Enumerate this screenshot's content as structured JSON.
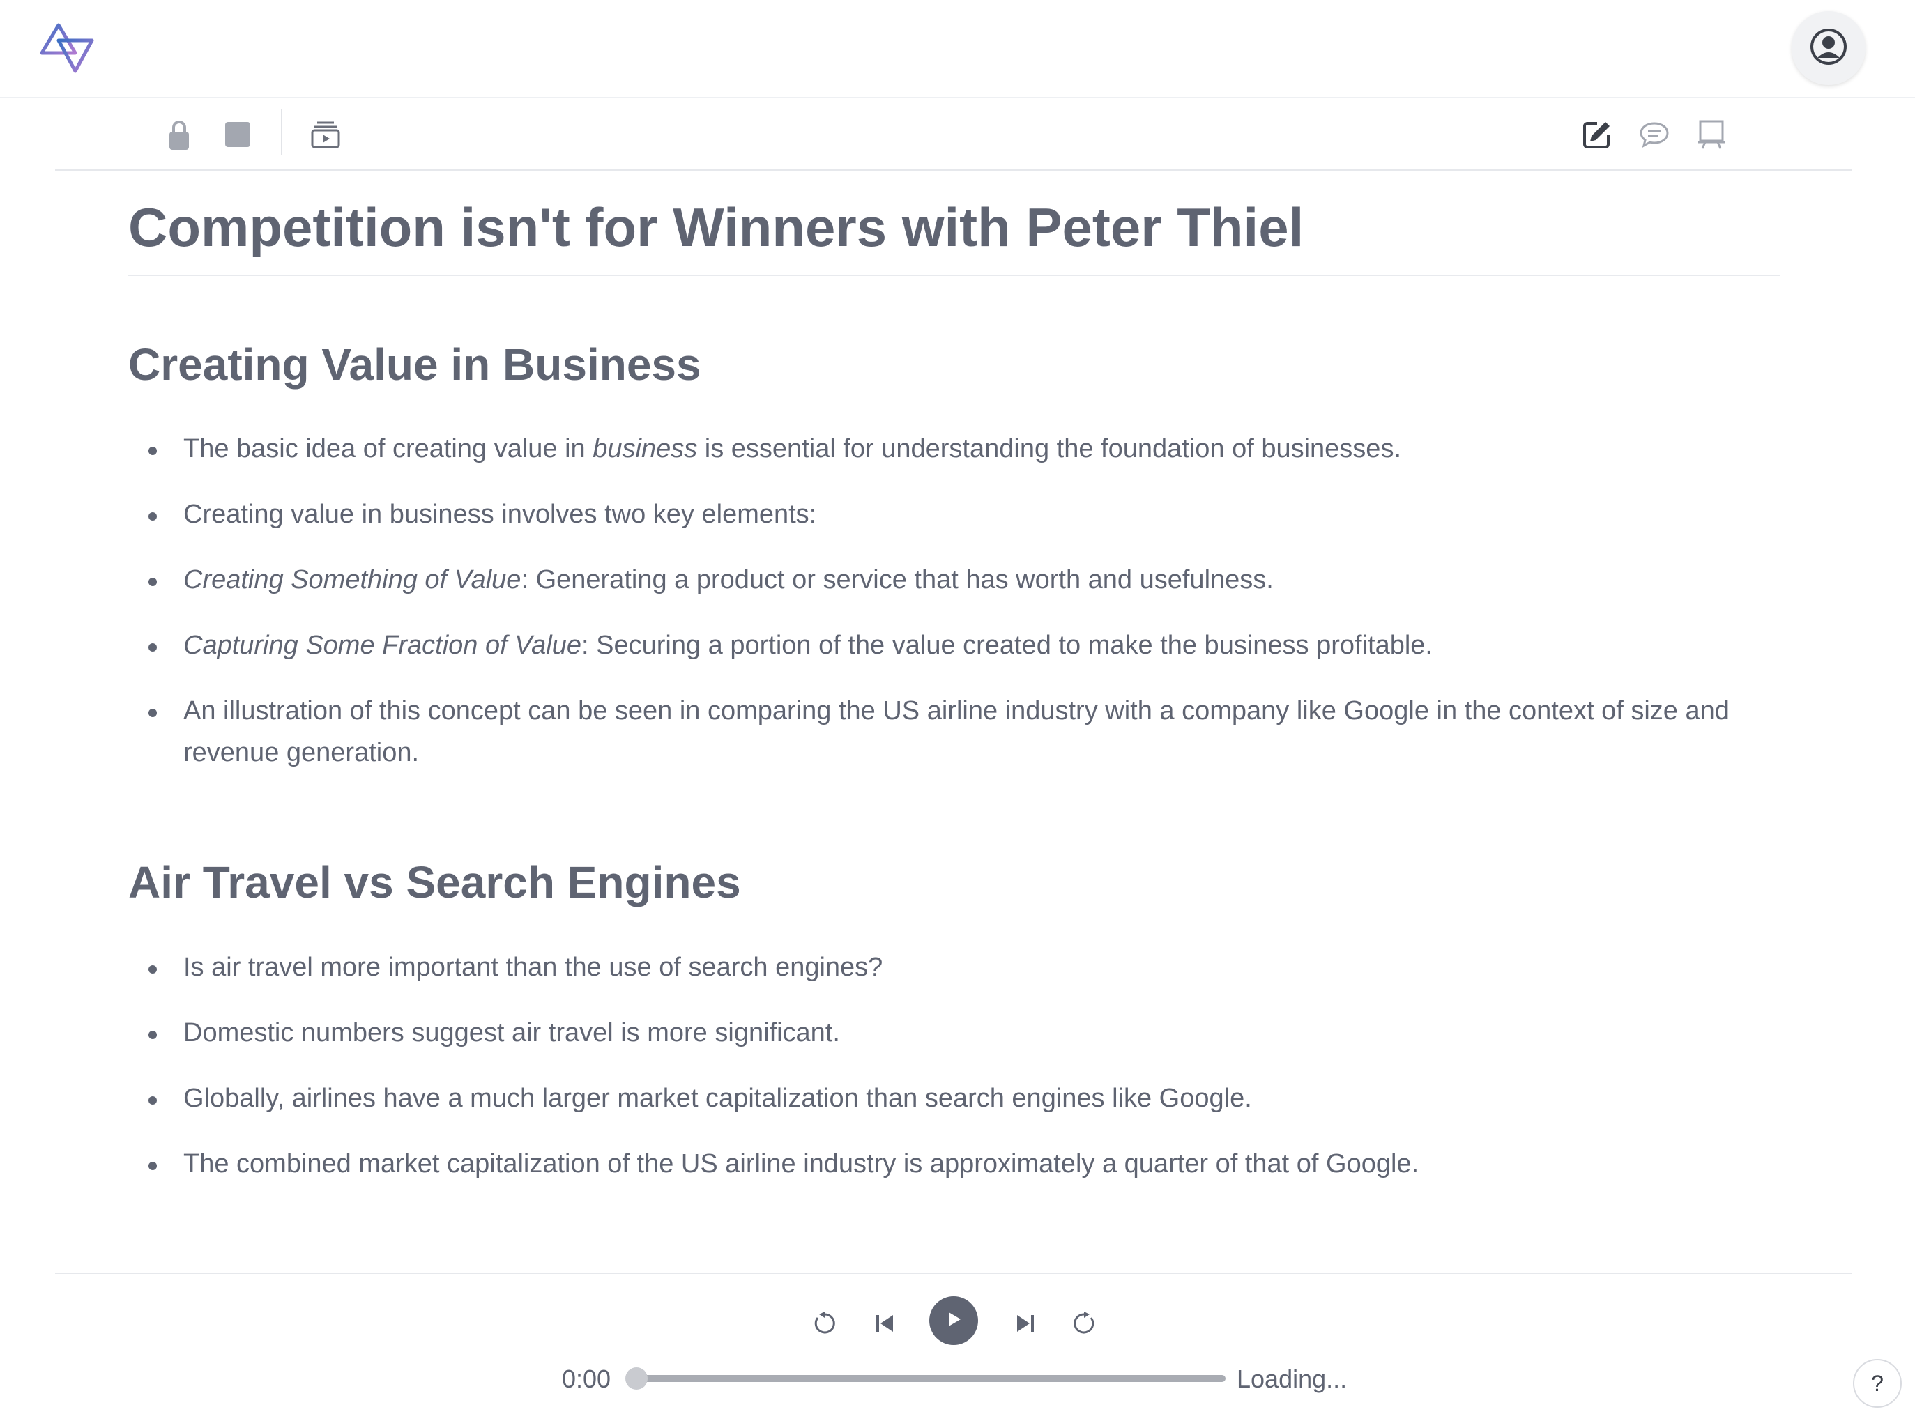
{
  "header": {
    "logo_icon": "triangles-logo-icon",
    "profile_icon": "user-circle-icon"
  },
  "toolbar": {
    "left_icons": [
      "lock-icon",
      "square-icon",
      "slideshow-icon"
    ],
    "right_icons": [
      "edit-icon",
      "comment-icon",
      "presentation-board-icon"
    ]
  },
  "document": {
    "title": "Competition isn't for Winners with Peter Thiel",
    "sections": [
      {
        "heading": "Creating Value in Business",
        "bullets": [
          {
            "before": " The basic idea of creating value in ",
            "em": "business",
            "after": " is essential for understanding the foundation of businesses."
          },
          {
            "before": " Creating value in business involves two key elements:",
            "em": "",
            "after": ""
          },
          {
            "before": "",
            "em": "Creating Something of Value",
            "after": ": Generating a product or service that has worth and usefulness."
          },
          {
            "before": " ",
            "em": "Capturing Some Fraction of Value",
            "after": ": Securing a portion of the value created to make the business profitable."
          },
          {
            "before": " An illustration of this concept can be seen in comparing the US airline industry with a company like Google in the context of size and revenue generation.",
            "em": "",
            "after": ""
          }
        ]
      },
      {
        "heading": "Air Travel vs Search Engines",
        "bullets": [
          {
            "before": "Is air travel more important than the use of search engines?",
            "em": "",
            "after": ""
          },
          {
            "before": " Domestic numbers suggest air travel is more significant.",
            "em": "",
            "after": ""
          },
          {
            "before": " Globally, airlines have a much larger market capitalization than search engines like Google.",
            "em": "",
            "after": ""
          },
          {
            "before": " The combined market capitalization of the US airline industry is approximately a quarter of that of Google.",
            "em": "",
            "after": ""
          }
        ]
      }
    ]
  },
  "player": {
    "current_time": "0:00",
    "status": "Loading...",
    "progress": 0,
    "controls": [
      "rewind-icon",
      "skip-back-icon",
      "play-icon",
      "skip-forward-icon",
      "fast-forward-icon"
    ]
  },
  "help": {
    "label": "?"
  },
  "colors": {
    "text": "#5f6472",
    "divider": "#e6e8ec",
    "logo_blue": "#3b6fc4",
    "logo_purple": "#b07ad1"
  }
}
